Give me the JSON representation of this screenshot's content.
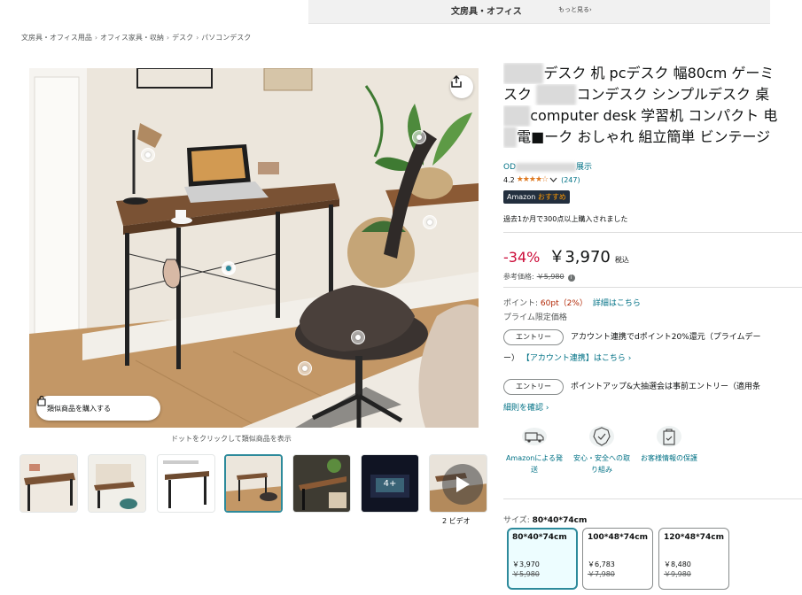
{
  "top_banner": {
    "category": "文房具・オフィス",
    "more": "もっと見る›"
  },
  "breadcrumb": [
    "文房具・オフィス用品",
    "オフィス家具・収納",
    "デスク",
    "パソコンデスク"
  ],
  "breadcrumb_sep": "›",
  "gallery": {
    "similar_button": "類似商品を購入する",
    "dot_hint": "ドットをクリックして類似商品を表示",
    "more_images_label": "4+",
    "video_label": "2 ビデオ",
    "icons": [
      "share-icon",
      "shopping-bag-icon",
      "play-icon"
    ]
  },
  "product": {
    "title_lines": [
      {
        "hidden": "■■■",
        "text": "デスク 机 pcデスク 幅80cm ゲーミ"
      },
      {
        "hidden": "",
        "text": "スク ",
        "hidden2": "■■■",
        "text2": "コンデスク シンプルデスク 桌"
      },
      {
        "hidden": "■■",
        "text": "computer desk 学習机 コンパクト 电"
      },
      {
        "hidden": "■",
        "text": "電■ーク おしゃれ 組立簡単 ビンテージ"
      }
    ],
    "store_prefix": "OD",
    "store_hidden": "■■■■■■■■",
    "store_suffix": "展示",
    "rating": "4.2",
    "stars": "★★★★☆",
    "rating_count": "(247)",
    "choice_badge": {
      "brand": "Amazon",
      "label": "おすすめ"
    },
    "purchase_note": "過去1か月で300点以上購入されました",
    "discount": "-34%",
    "price": "￥3,970",
    "tax_label": "税込",
    "ref_price_label": "参考価格:",
    "ref_price": "￥5,980",
    "points_label": "ポイント:",
    "points_value": "60pt（2%）",
    "points_link": "詳細はこちら",
    "prime_only": "プライム限定価格",
    "promotions": [
      {
        "button": "エントリー",
        "text": "アカウント連携でdポイント20%還元（プライムデー",
        "line2_prefix": "ー）",
        "line2_link": "【アカウント連携】はこちら ›"
      },
      {
        "button": "エントリー",
        "text": "ポイントアップ&大抽選会は事前エントリー（適用条",
        "line2_link": "細則を確認 ›"
      }
    ],
    "features": [
      {
        "icon": "delivery-truck-icon",
        "label": "Amazonによる発送"
      },
      {
        "icon": "safety-badge-icon",
        "label": "安心・安全への取り組み"
      },
      {
        "icon": "secure-transaction-icon",
        "label": "お客様情報の保護"
      }
    ],
    "size_label": "サイズ:",
    "size_selected": "80*40*74cm",
    "sizes": [
      {
        "name": "80*40*74cm",
        "price": "￥3,970",
        "strike": "￥5,980",
        "selected": true
      },
      {
        "name": "100*48*74cm",
        "price": "￥6,783",
        "strike": "￥7,980",
        "selected": false
      },
      {
        "name": "120*48*74cm",
        "price": "￥8,480",
        "strike": "￥9,980",
        "selected": false
      }
    ]
  },
  "colors": {
    "accent": "#2d8a9b",
    "link": "#007185",
    "discount": "#cc0c39",
    "star": "#de7921",
    "points": "#b12704"
  }
}
